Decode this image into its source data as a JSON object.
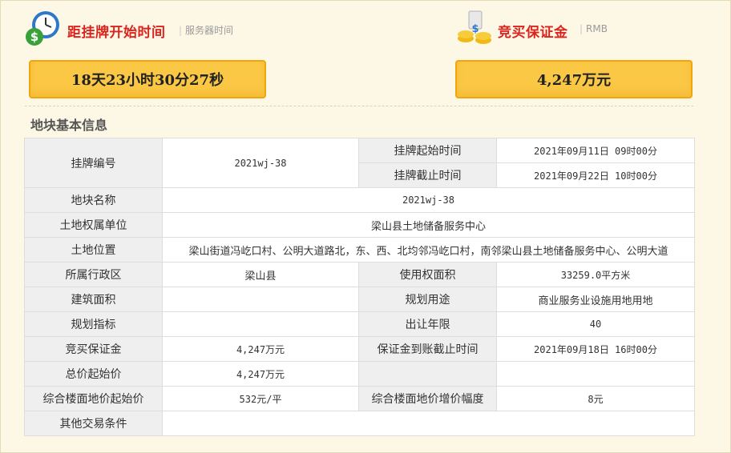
{
  "countdown": {
    "title": "距挂牌开始时间",
    "subtitle": "服务器时间",
    "value": "18天23小时30分27秒",
    "icon": "clock-money-icon"
  },
  "deposit": {
    "title": "竞买保证金",
    "subtitle": "RMB",
    "value": "4,247万元",
    "icon": "coins-icon"
  },
  "section_title": "地块基本信息",
  "table": {
    "listing_no": {
      "label": "挂牌编号",
      "value": "2021wj-38"
    },
    "listing_start": {
      "label": "挂牌起始时间",
      "value": "2021年09月11日 09时00分"
    },
    "listing_end": {
      "label": "挂牌截止时间",
      "value": "2021年09月22日 10时00分"
    },
    "parcel_name": {
      "label": "地块名称",
      "value": "2021wj-38"
    },
    "owner_unit": {
      "label": "土地权属单位",
      "value": "梁山县土地储备服务中心"
    },
    "location": {
      "label": "土地位置",
      "value": "梁山街道冯屹口村、公明大道路北，东、西、北均邻冯屹口村，南邻梁山县土地储备服务中心、公明大道"
    },
    "district": {
      "label": "所属行政区",
      "value": "梁山县"
    },
    "use_area": {
      "label": "使用权面积",
      "value": "33259.0平方米"
    },
    "build_area": {
      "label": "建筑面积",
      "value": ""
    },
    "planned_use": {
      "label": "规划用途",
      "value": "商业服务业设施用地用地"
    },
    "plan_index": {
      "label": "规划指标",
      "value": ""
    },
    "term": {
      "label": "出让年限",
      "value": "40"
    },
    "deposit": {
      "label": "竞买保证金",
      "value": "4,247万元"
    },
    "deposit_deadline": {
      "label": "保证金到账截止时间",
      "value": "2021年09月18日 16时00分"
    },
    "start_price": {
      "label": "总价起始价",
      "value": "4,247万元"
    },
    "floor_price": {
      "label": "综合楼面地价起始价",
      "value": "532元/平"
    },
    "floor_increment": {
      "label": "综合楼面地价增价幅度",
      "value": "8元"
    },
    "other": {
      "label": "其他交易条件",
      "value": ""
    }
  }
}
